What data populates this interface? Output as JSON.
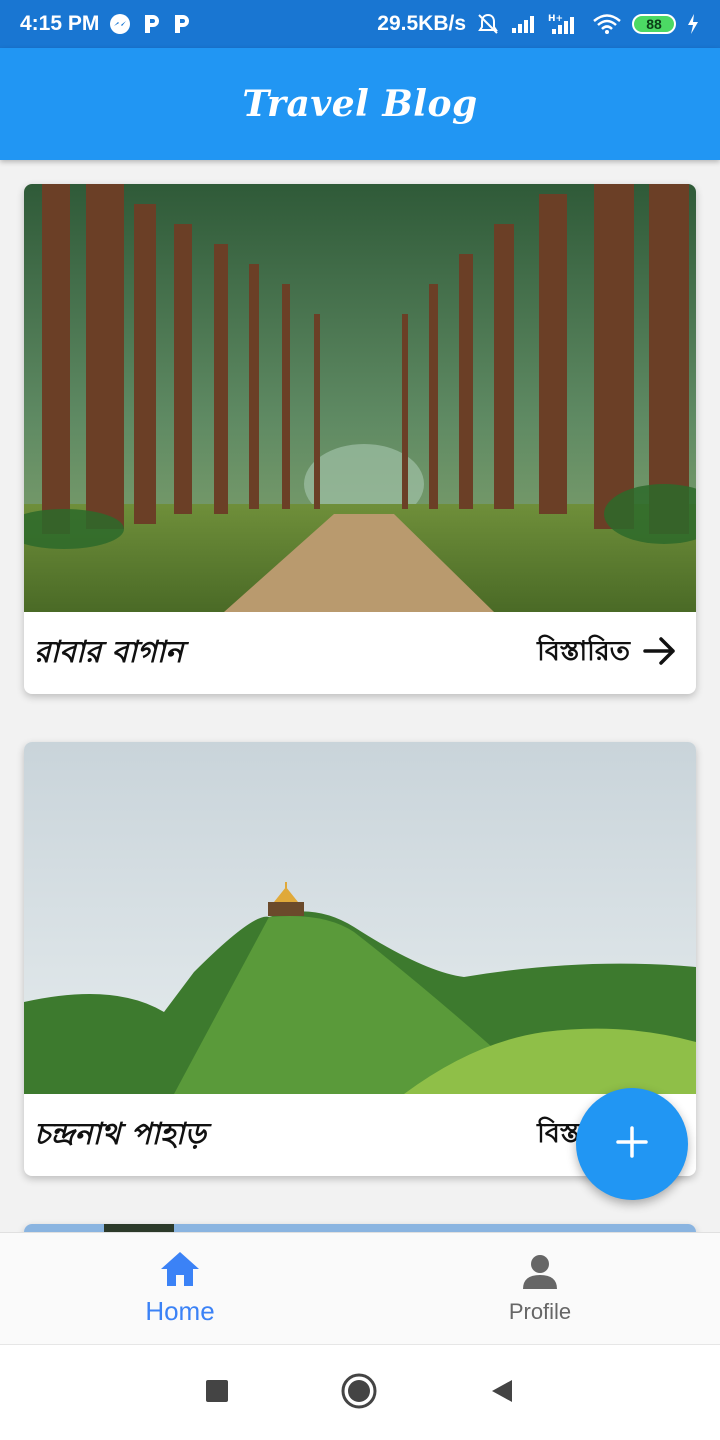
{
  "status_bar": {
    "time": "4:15 PM",
    "network_speed": "29.5KB/s",
    "battery": "88",
    "icons": [
      "messenger-icon",
      "p-app-icon",
      "p-app-icon",
      "mute-icon",
      "signal-icon",
      "signal-h-icon",
      "wifi-icon",
      "charging-icon"
    ]
  },
  "app_bar": {
    "title": "Travel Blog"
  },
  "posts": [
    {
      "title": "রাবার বাগান",
      "details_label": "বিস্তারিত",
      "image": "forest-road-photo"
    },
    {
      "title": "চন্দ্রনাথ পাহাড়",
      "details_label": "বিস্তারিত",
      "image": "hill-temple-photo"
    }
  ],
  "fab": {
    "icon": "plus-icon"
  },
  "bottom_nav": {
    "items": [
      {
        "label": "Home",
        "icon": "home-icon",
        "active": true
      },
      {
        "label": "Profile",
        "icon": "person-icon",
        "active": false
      }
    ]
  },
  "colors": {
    "status_bar": "#1976d2",
    "primary": "#2196f3",
    "active_nav": "#3b82f6"
  }
}
